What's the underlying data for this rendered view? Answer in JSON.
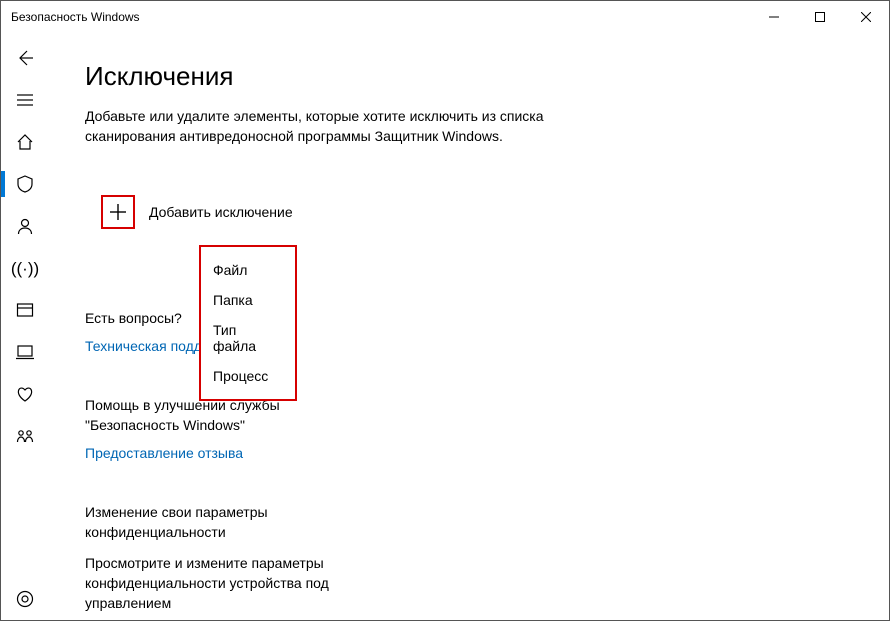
{
  "titlebar": {
    "title": "Безопасность Windows"
  },
  "main": {
    "title": "Исключения",
    "description": "Добавьте или удалите элементы, которые хотите исключить из списка сканирования антивредоносной программы Защитник Windows.",
    "add_label": "Добавить исключение",
    "dropdown": [
      "Файл",
      "Папка",
      "Тип файла",
      "Процесс"
    ],
    "questions": {
      "heading": "Есть вопросы?",
      "link": "Техническая поддержка"
    },
    "feedback": {
      "heading": "Помощь в улучшении службы \"Безопасность Windows\"",
      "link": "Предоставление отзыва"
    },
    "privacy": {
      "heading": "Изменение свои параметры конфиденциальности",
      "body": "Просмотрите и измените параметры конфиденциальности устройства под управлением"
    }
  },
  "highlight_color": "#d60000",
  "link_color": "#0066b4",
  "accent_color": "#0078d4"
}
